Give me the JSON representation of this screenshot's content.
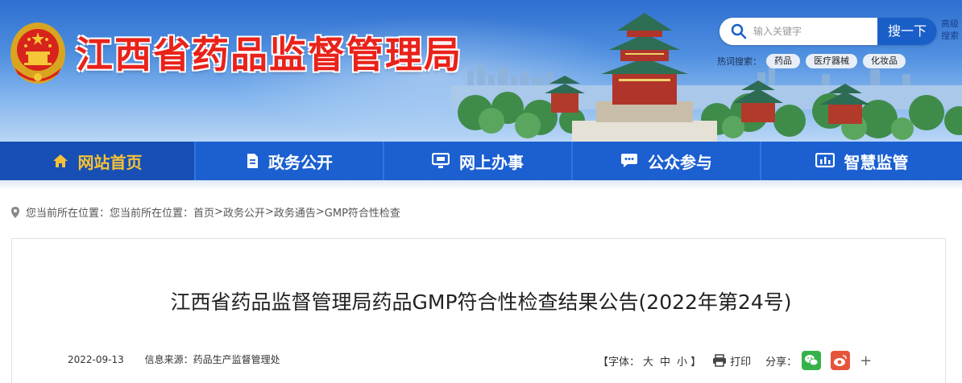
{
  "header": {
    "site_title": "江西省药品监督管理局",
    "search_placeholder": "输入关键字",
    "search_button": "搜一下",
    "advanced_search": "高级搜索",
    "hot_search_label": "热词搜索：",
    "hot_tags": [
      "药品",
      "医疗器械",
      "化妆品"
    ]
  },
  "nav": {
    "items": [
      {
        "label": "网站首页",
        "icon": "home-icon"
      },
      {
        "label": "政务公开",
        "icon": "document-icon"
      },
      {
        "label": "网上办事",
        "icon": "monitor-icon"
      },
      {
        "label": "公众参与",
        "icon": "chat-icon"
      },
      {
        "label": "智慧监管",
        "icon": "dashboard-icon"
      }
    ],
    "active_index": 0
  },
  "breadcrumb": {
    "prefix": "您当前所在位置：您当前所在位置：",
    "items": [
      "首页",
      "政务公开",
      "政务通告",
      "GMP符合性检查"
    ],
    "separator": ">"
  },
  "article": {
    "title": "江西省药品监督管理局药品GMP符合性检查结果公告(2022年第24号)",
    "date": "2022-09-13",
    "source": "信息来源：药品生产监督管理处"
  },
  "tools": {
    "font_prefix": "【字体：",
    "font_large": "大",
    "font_medium": "中",
    "font_small": "小",
    "font_suffix": "】",
    "print": "打印",
    "share_label": "分享：",
    "more": "+"
  },
  "colors": {
    "nav_blue": "#1b5fd0",
    "nav_active_text": "#f6c235",
    "title_red": "#e9221a",
    "search_button": "#1a5fc8"
  }
}
